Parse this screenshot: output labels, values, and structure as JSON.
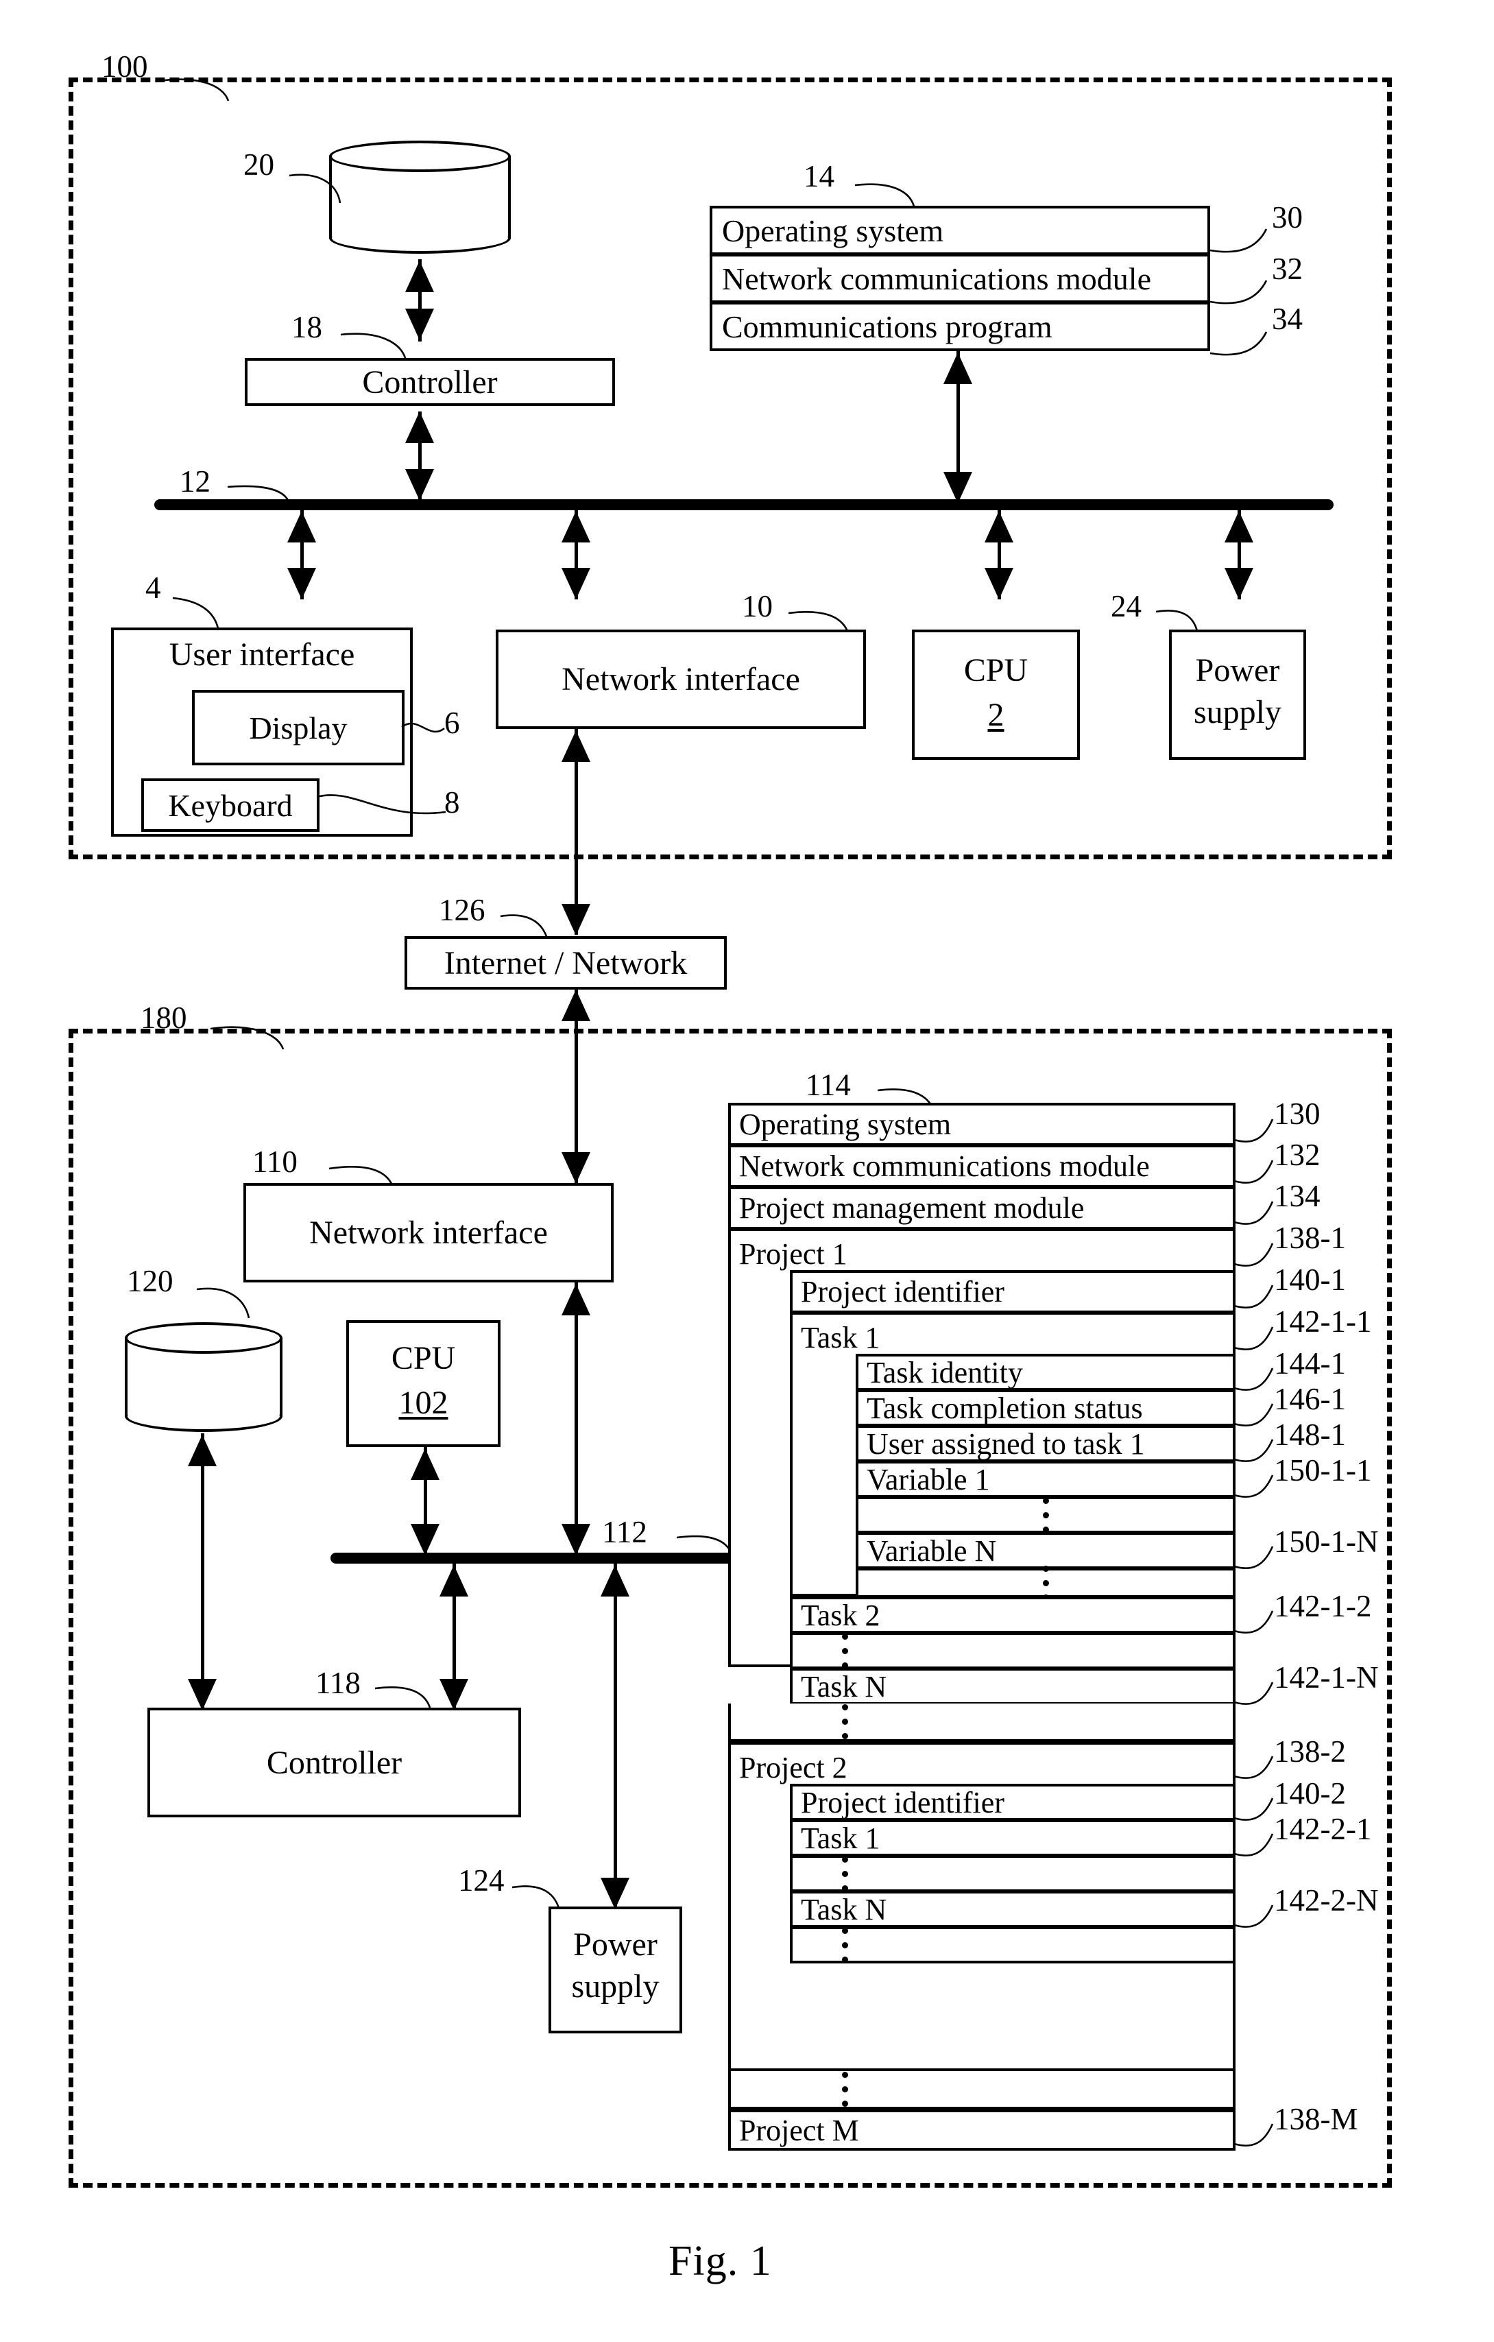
{
  "figure": {
    "caption": "Fig. 1"
  },
  "client_system": {
    "ref": "100",
    "bus": {
      "ref": "12"
    },
    "storage": {
      "ref": "20",
      "name": "disk-storage"
    },
    "controller": {
      "ref": "18",
      "label": "Controller"
    },
    "memory": {
      "ref": "14",
      "rows": [
        {
          "label": "Operating system",
          "ref": "30"
        },
        {
          "label": "Network communications module",
          "ref": "32"
        },
        {
          "label": "Communications program",
          "ref": "34"
        }
      ]
    },
    "user_interface": {
      "ref": "4",
      "label": "User interface",
      "display": {
        "ref": "6",
        "label": "Display"
      },
      "keyboard": {
        "ref": "8",
        "label": "Keyboard"
      }
    },
    "network_interface": {
      "ref": "10",
      "label": "Network interface"
    },
    "cpu": {
      "label": "CPU",
      "ref": "2"
    },
    "power_supply": {
      "ref": "24",
      "label_line1": "Power",
      "label_line2": "supply"
    }
  },
  "network": {
    "ref": "126",
    "label": "Internet / Network"
  },
  "server_system": {
    "ref": "180",
    "bus": {
      "ref": "112"
    },
    "storage": {
      "ref": "120",
      "name": "disk-storage"
    },
    "controller": {
      "ref": "118",
      "label": "Controller"
    },
    "network_interface": {
      "ref": "110",
      "label": "Network interface"
    },
    "cpu": {
      "label": "CPU",
      "ref": "102"
    },
    "power_supply": {
      "ref": "124",
      "label_line1": "Power",
      "label_line2": "supply"
    },
    "memory": {
      "ref": "114",
      "rows": [
        {
          "label": "Operating system",
          "ref": "130"
        },
        {
          "label": "Network communications module",
          "ref": "132"
        },
        {
          "label": "Project management module",
          "ref": "134"
        },
        {
          "label": "Project 1",
          "ref": "138-1"
        },
        {
          "label": "Project identifier",
          "ref": "140-1"
        },
        {
          "label": "Task 1",
          "ref": "142-1-1"
        },
        {
          "label": "Task identity",
          "ref": "144-1"
        },
        {
          "label": "Task completion status",
          "ref": "146-1"
        },
        {
          "label": "User assigned to task 1",
          "ref": "148-1"
        },
        {
          "label": "Variable 1",
          "ref": "150-1-1"
        },
        {
          "label": "Variable N",
          "ref": "150-1-N"
        },
        {
          "label": "Task 2",
          "ref": "142-1-2"
        },
        {
          "label": "Task N",
          "ref": "142-1-N"
        },
        {
          "label": "Project 2",
          "ref": "138-2"
        },
        {
          "label": "Project identifier",
          "ref": "140-2"
        },
        {
          "label": "Task 1",
          "ref": "142-2-1"
        },
        {
          "label": "Task N",
          "ref": "142-2-N"
        },
        {
          "label": "Project M",
          "ref": "138-M"
        }
      ]
    }
  }
}
